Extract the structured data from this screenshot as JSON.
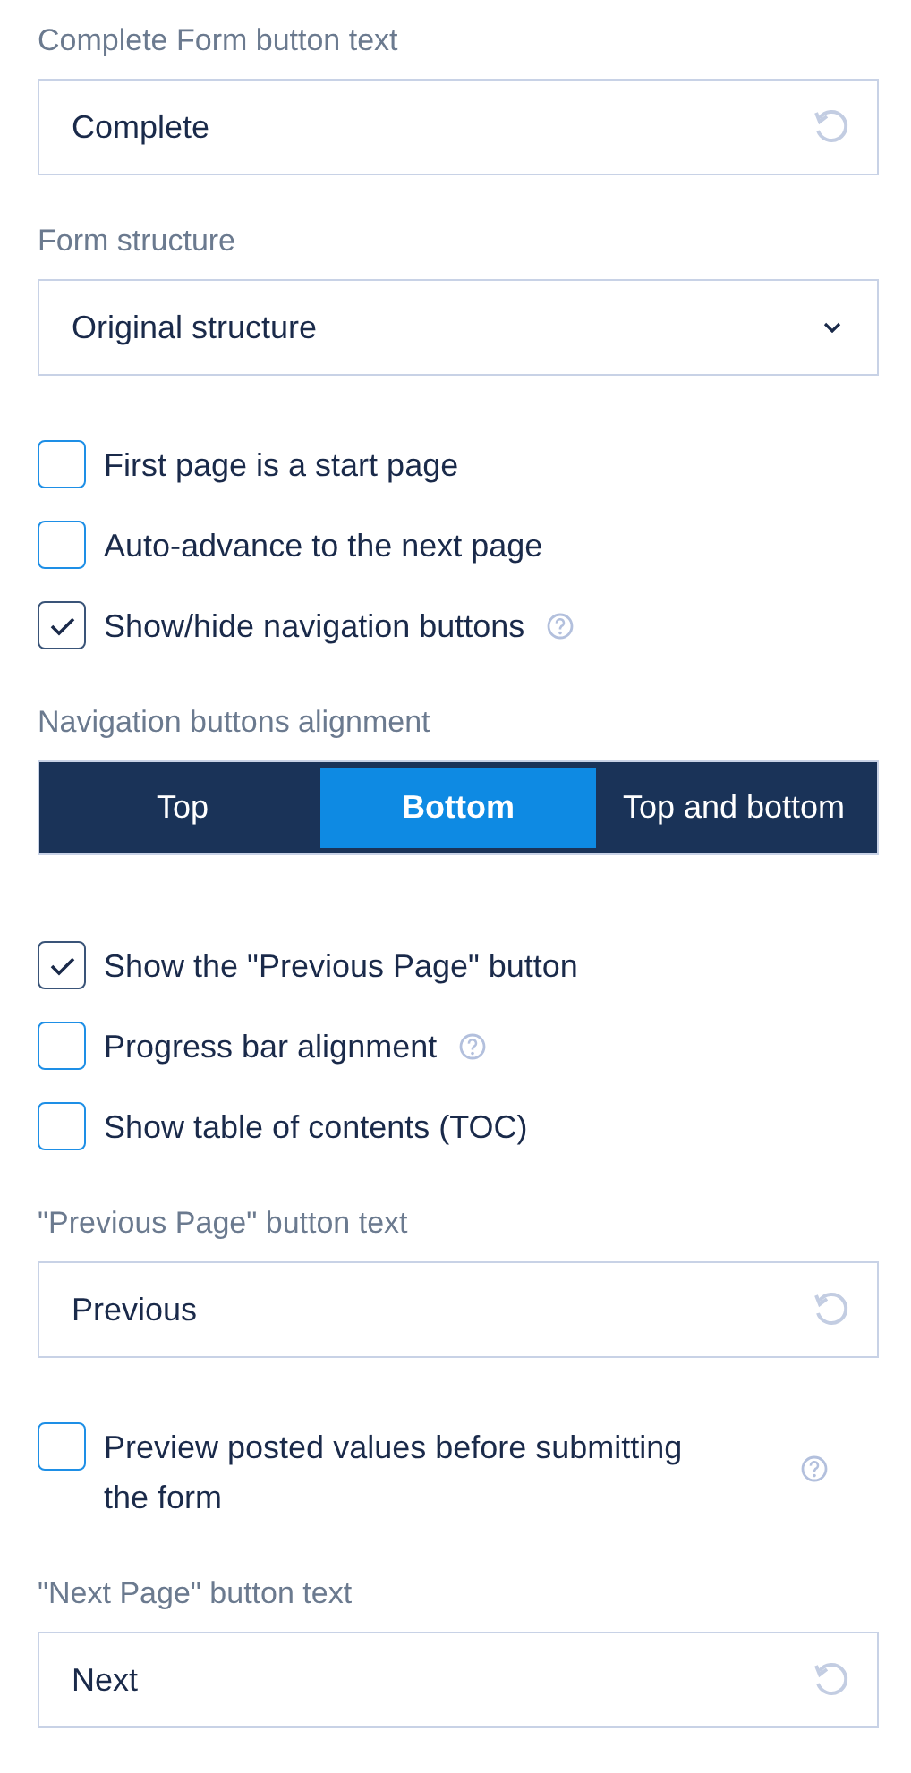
{
  "settings": [
    {
      "kind": "text_field",
      "label": "Complete Form button text",
      "value": "Complete"
    },
    {
      "kind": "select",
      "label": "Form structure",
      "value": "Original structure"
    },
    {
      "kind": "checkbox",
      "label": "First page is a start page",
      "checked": false,
      "help": false
    },
    {
      "kind": "checkbox",
      "label": "Auto-advance to the next page",
      "checked": false,
      "help": false
    },
    {
      "kind": "checkbox",
      "label": "Show/hide navigation buttons",
      "checked": true,
      "help": true
    },
    {
      "kind": "segmented",
      "label": "Navigation buttons alignment",
      "options": [
        {
          "label": "Top",
          "selected": false
        },
        {
          "label": "Bottom",
          "selected": true
        },
        {
          "label": "Top and bottom",
          "selected": false
        }
      ]
    },
    {
      "kind": "checkbox",
      "label": "Show the \"Previous Page\" button",
      "checked": true,
      "help": false
    },
    {
      "kind": "checkbox",
      "label": "Progress bar alignment",
      "checked": false,
      "help": true
    },
    {
      "kind": "checkbox",
      "label": "Show table of contents (TOC)",
      "checked": false,
      "help": false
    },
    {
      "kind": "text_field",
      "label": "\"Previous Page\" button text",
      "value": "Previous"
    },
    {
      "kind": "checkbox",
      "label": "Preview posted values before submitting the form",
      "checked": false,
      "help": true
    },
    {
      "kind": "text_field",
      "label": "\"Next Page\" button text",
      "value": "Next"
    }
  ]
}
